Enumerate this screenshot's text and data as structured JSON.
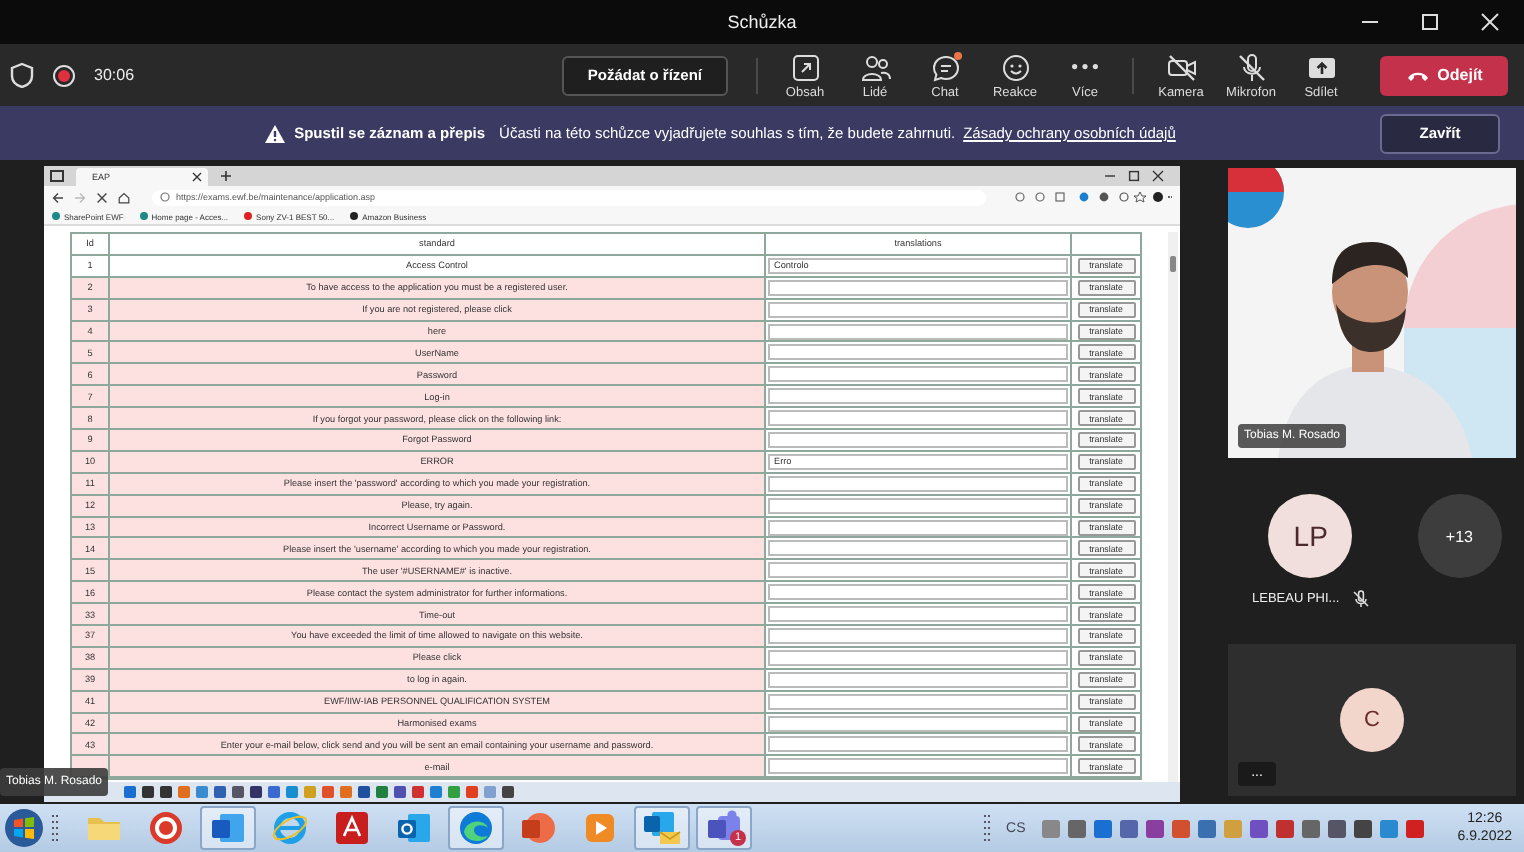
{
  "window": {
    "title": "Schůzka"
  },
  "toolbar": {
    "timer": "30:06",
    "request_control": "Požádat o řízení",
    "leave": "Odejít",
    "buttons": [
      {
        "label": "Obsah",
        "kind": "content"
      },
      {
        "label": "Lidé",
        "kind": "people"
      },
      {
        "label": "Chat",
        "kind": "chat",
        "notification": true
      },
      {
        "label": "Reakce",
        "kind": "reactions"
      },
      {
        "label": "Více",
        "kind": "more"
      },
      {
        "label": "Kamera",
        "kind": "camera",
        "off": true
      },
      {
        "label": "Mikrofon",
        "kind": "mic",
        "off": true
      },
      {
        "label": "Sdílet",
        "kind": "share"
      }
    ]
  },
  "banner": {
    "title": "Spustil se záznam a přepis",
    "message": "Účasti na této schůzce vyjadřujete souhlas s tím, že budete zahrnuti.",
    "link": "Zásady ochrany osobních údajů",
    "close": "Zavřít"
  },
  "shared_screen": {
    "presenter": "Tobias M. Rosado",
    "browser": {
      "tab": "EAP",
      "url": "https://exams.ewf.be/maintenance/application.asp",
      "bookmarks": [
        {
          "label": "SharePoint EWF",
          "color": "#1a8a8a"
        },
        {
          "label": "Home page - Acces...",
          "color": "#1a8a8a"
        },
        {
          "label": "Sony ZV-1 BEST 50...",
          "color": "#e02020"
        },
        {
          "label": "Amazon Business",
          "color": "#222222"
        }
      ]
    },
    "table": {
      "columns": [
        "Id",
        "standard",
        "translations"
      ],
      "rows": [
        {
          "id": "1",
          "standard": "Access Control",
          "value": "Controlo",
          "button": "translate",
          "highlighted": false
        },
        {
          "id": "2",
          "standard": "To have access to the application you must be a registered user.",
          "button": "translate",
          "highlighted": true
        },
        {
          "id": "3",
          "standard": "If you are not registered, please click",
          "button": "translate",
          "highlighted": true
        },
        {
          "id": "4",
          "standard": "here",
          "button": "translate",
          "highlighted": true
        },
        {
          "id": "5",
          "standard": "UserName",
          "button": "translate",
          "highlighted": true
        },
        {
          "id": "6",
          "standard": "Password",
          "button": "translate",
          "highlighted": true
        },
        {
          "id": "7",
          "standard": "Log-in",
          "button": "translate",
          "highlighted": true
        },
        {
          "id": "8",
          "standard": "If you forgot your password, please click on the following link:",
          "button": "translate",
          "highlighted": true
        },
        {
          "id": "9",
          "standard": "Forgot Password",
          "button": "translate",
          "highlighted": true
        },
        {
          "id": "10",
          "standard": "ERROR",
          "value": "Erro",
          "button": "translate",
          "highlighted": true
        },
        {
          "id": "11",
          "standard": "Please insert the 'password' according to which you made your registration.",
          "button": "translate",
          "highlighted": true
        },
        {
          "id": "12",
          "standard": "Please, try again.",
          "button": "translate",
          "highlighted": true
        },
        {
          "id": "13",
          "standard": "Incorrect Username or Password.",
          "button": "translate",
          "highlighted": true
        },
        {
          "id": "14",
          "standard": "Please insert the 'username' according to which you made your registration.",
          "button": "translate",
          "highlighted": true
        },
        {
          "id": "15",
          "standard": "The user '#USERNAME#' is inactive.",
          "button": "translate",
          "highlighted": true
        },
        {
          "id": "16",
          "standard": "Please contact the system administrator for further informations.",
          "button": "translate",
          "highlighted": true
        },
        {
          "id": "33",
          "standard": "Time-out",
          "button": "translate",
          "highlighted": true
        },
        {
          "id": "37",
          "standard": "You have exceeded the limit of time allowed to navigate on this website.",
          "button": "translate",
          "highlighted": true
        },
        {
          "id": "38",
          "standard": "Please click",
          "button": "translate",
          "highlighted": true
        },
        {
          "id": "39",
          "standard": "to log in again.",
          "button": "translate",
          "highlighted": true
        },
        {
          "id": "41",
          "standard": "EWF/IIW-IAB PERSONNEL QUALIFICATION SYSTEM",
          "button": "translate",
          "highlighted": true
        },
        {
          "id": "42",
          "standard": "Harmonised exams",
          "button": "translate",
          "highlighted": true
        },
        {
          "id": "43",
          "standard": "Enter your e-mail below, click send and you will be sent an email containing your username and password.",
          "button": "translate",
          "highlighted": true
        },
        {
          "standard": "e-mail",
          "button": "translate",
          "highlighted": true
        }
      ]
    }
  },
  "participants": {
    "video": {
      "name": "Tobias M. Rosado",
      "kind": "picture"
    },
    "avatars": [
      {
        "initials": "LP",
        "name": "LEBEAU PHI...",
        "muted": true,
        "color": "#f0dfdc"
      },
      {
        "initials": "+13",
        "color": "#3d3d3d"
      }
    ],
    "tile": {
      "initials": "C",
      "color": "#f3d6cb"
    },
    "more": "..."
  },
  "taskbar": {
    "apps": [
      {
        "kind": "folder",
        "active": false
      },
      {
        "kind": "redcircle",
        "active": false
      },
      {
        "kind": "word",
        "active": true
      },
      {
        "kind": "ie",
        "active": false
      },
      {
        "kind": "acrobat",
        "active": false
      },
      {
        "kind": "outlook",
        "active": false
      },
      {
        "kind": "edge",
        "active": true
      },
      {
        "kind": "powerpoint",
        "active": false
      },
      {
        "kind": "player",
        "active": false
      },
      {
        "kind": "outlookmail",
        "active": true
      },
      {
        "kind": "teams",
        "active": true,
        "badge": "1"
      }
    ],
    "language": "CS",
    "time": "12:26",
    "date": "6.9.2022"
  }
}
